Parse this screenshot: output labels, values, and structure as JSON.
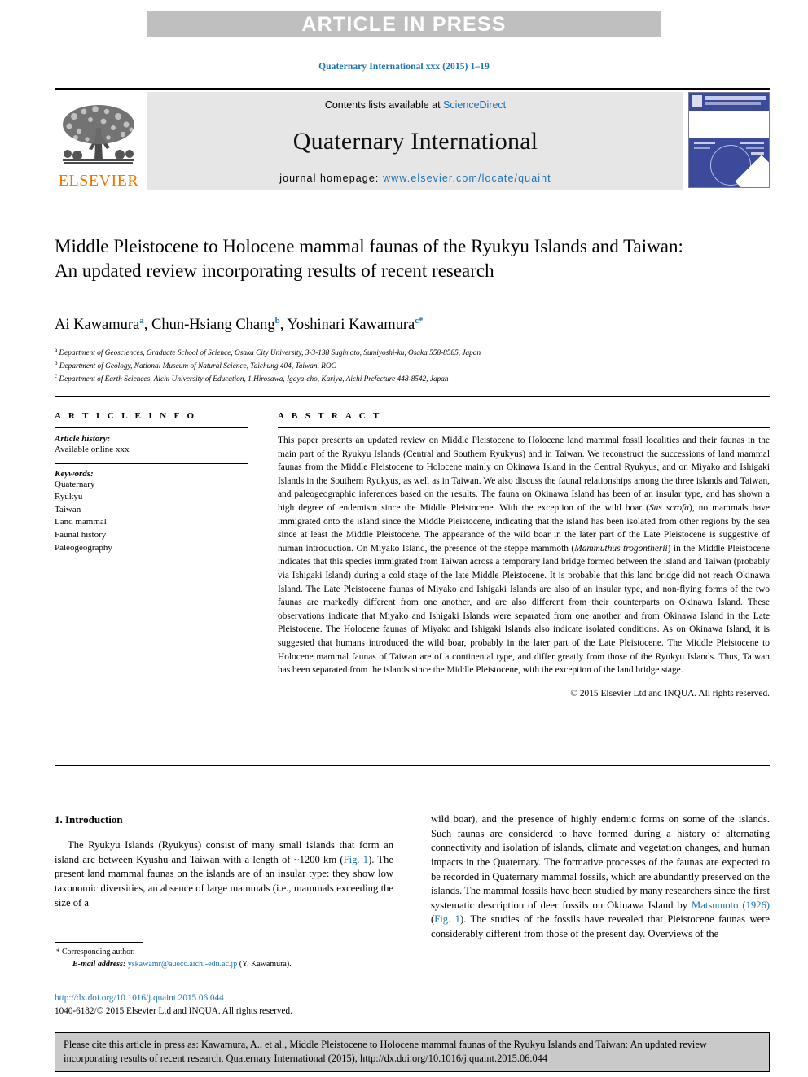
{
  "banner": {
    "text": "ARTICLE IN PRESS"
  },
  "journal_ref": "Quaternary International xxx (2015) 1–19",
  "masthead": {
    "publisher_name": "ELSEVIER",
    "contents_prefix": "Contents lists available at ",
    "contents_link": "ScienceDirect",
    "journal_title": "Quaternary International",
    "homepage_prefix": "journal homepage: ",
    "homepage_url": "www.elsevier.com/locate/quaint"
  },
  "article": {
    "title": "Middle Pleistocene to Holocene mammal faunas of the Ryukyu Islands and Taiwan: An updated review incorporating results of recent research",
    "authors": [
      {
        "name": "Ai Kawamura",
        "marker": "a"
      },
      {
        "name": "Chun-Hsiang Chang",
        "marker": "b"
      },
      {
        "name": "Yoshinari Kawamura",
        "marker": "c",
        "corresponding": "*"
      }
    ],
    "affiliations": [
      {
        "marker": "a",
        "text": "Department of Geosciences, Graduate School of Science, Osaka City University, 3-3-138 Sugimoto, Sumiyoshi-ku, Osaka 558-8585, Japan"
      },
      {
        "marker": "b",
        "text": "Department of Geology, National Museum of Natural Science, Taichung 404, Taiwan, ROC"
      },
      {
        "marker": "c",
        "text": "Department of Earth Sciences, Aichi University of Education, 1 Hirosawa, Igaya-cho, Kariya, Aichi Prefecture 448-8542, Japan"
      }
    ]
  },
  "article_info": {
    "heading": "A R T I C L E   I N F O",
    "history_label": "Article history:",
    "history_value": "Available online xxx",
    "keywords_label": "Keywords:",
    "keywords": [
      "Quaternary",
      "Ryukyu",
      "Taiwan",
      "Land mammal",
      "Faunal history",
      "Paleogeography"
    ]
  },
  "abstract": {
    "heading": "A B S T R A C T",
    "paragraph_1": "This paper presents an updated review on Middle Pleistocene to Holocene land mammal fossil localities and their faunas in the main part of the Ryukyu Islands (Central and Southern Ryukyus) and in Taiwan. We reconstruct the successions of land mammal faunas from the Middle Pleistocene to Holocene mainly on Okinawa Island in the Central Ryukyus, and on Miyako and Ishigaki Islands in the Southern Ryukyus, as well as in Taiwan. We also discuss the faunal relationships among the three islands and Taiwan, and paleogeographic inferences based on the results. The fauna on Okinawa Island has been of an insular type, and has shown a high degree of endemism since the Middle Pleistocene. With the exception of the wild boar (",
    "species_1": "Sus scrofa",
    "paragraph_2": "), no mammals have immigrated onto the island since the Middle Pleistocene, indicating that the island has been isolated from other regions by the sea since at least the Middle Pleistocene. The appearance of the wild boar in the later part of the Late Pleistocene is suggestive of human introduction. On Miyako Island, the presence of the steppe mammoth (",
    "species_2": "Mammuthus trogontherii",
    "paragraph_3": ") in the Middle Pleistocene indicates that this species immigrated from Taiwan across a temporary land bridge formed between the island and Taiwan (probably via Ishigaki Island) during a cold stage of the late Middle Pleistocene. It is probable that this land bridge did not reach Okinawa Island. The Late Pleistocene faunas of Miyako and Ishigaki Islands are also of an insular type, and non-flying forms of the two faunas are markedly different from one another, and are also different from their counterparts on Okinawa Island. These observations indicate that Miyako and Ishigaki Islands were separated from one another and from Okinawa Island in the Late Pleistocene. The Holocene faunas of Miyako and Ishigaki Islands also indicate isolated conditions. As on Okinawa Island, it is suggested that humans introduced the wild boar, probably in the later part of the Late Pleistocene. The Middle Pleistocene to Holocene mammal faunas of Taiwan are of a continental type, and differ greatly from those of the Ryukyu Islands. Thus, Taiwan has been separated from the islands since the Middle Pleistocene, with the exception of the land bridge stage.",
    "copyright": "© 2015 Elsevier Ltd and INQUA. All rights reserved."
  },
  "body": {
    "section_number_title": "1. Introduction",
    "left_p1_a": "The Ryukyu Islands (Ryukyus) consist of many small islands that form an island arc between Kyushu and Taiwan with a length of ~1200 km (",
    "left_link_1": "Fig. 1",
    "left_p1_b": "). The present land mammal faunas on the islands are of an insular type: they show low taxonomic diversities, an absence of large mammals (i.e., mammals exceeding the size of a",
    "right_p1_a": "wild boar), and the presence of highly endemic forms on some of the islands. Such faunas are considered to have formed during a history of alternating connectivity and isolation of islands, climate and vegetation changes, and human impacts in the Quaternary. The formative processes of the faunas are expected to be recorded in Quaternary mammal fossils, which are abundantly preserved on the islands. The mammal fossils have been studied by many researchers since the first systematic description of deer fossils on Okinawa Island by ",
    "right_link_1": "Matsumoto (1926)",
    "right_p1_b": " (",
    "right_link_2": "Fig. 1",
    "right_p1_c": "). The studies of the fossils have revealed that Pleistocene faunas were considerably different from those of the present day. Overviews of the"
  },
  "footnote": {
    "star": "*",
    "corresponding_label": "Corresponding author.",
    "email_label": "E-mail address:",
    "email": "yskawamr@auecc.aichi-edu.ac.jp",
    "email_suffix": "(Y. Kawamura)."
  },
  "doi_block": {
    "doi_url": "http://dx.doi.org/10.1016/j.quaint.2015.06.044",
    "issn_line": "1040-6182/© 2015 Elsevier Ltd and INQUA. All rights reserved."
  },
  "cite_box": {
    "text": "Please cite this article in press as: Kawamura, A., et al., Middle Pleistocene to Holocene mammal faunas of the Ryukyu Islands and Taiwan: An updated review incorporating results of recent research, Quaternary International (2015), http://dx.doi.org/10.1016/j.quaint.2015.06.044"
  },
  "colors": {
    "link_blue": "#1a72b8",
    "banner_gray": "#bfbfbf",
    "panel_gray": "#e6e6e6",
    "elsevier_orange": "#ee7600",
    "cite_box_gray": "#c9c9c9"
  }
}
